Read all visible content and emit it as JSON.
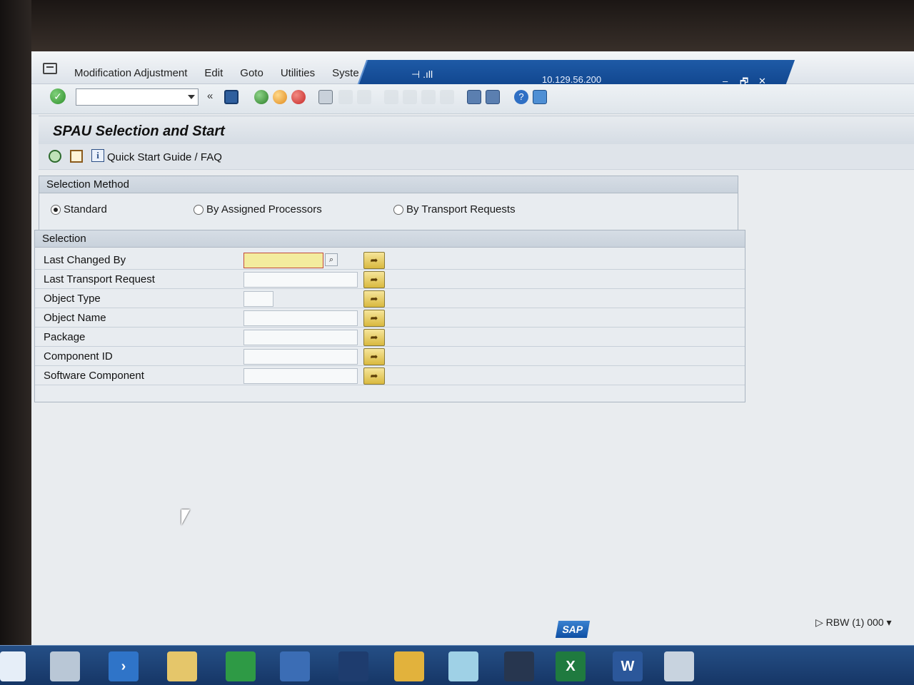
{
  "menubar": {
    "items": [
      "Modification Adjustment",
      "Edit",
      "Goto",
      "Utilities",
      "Syste"
    ],
    "server_ip": "10.129.56.200",
    "window_controls": [
      "–",
      "🗗",
      "✕"
    ]
  },
  "toolbar": {
    "back_label": "«"
  },
  "page": {
    "title": "SPAU Selection and Start",
    "quick_start_label": "Quick Start Guide / FAQ",
    "info_icon_text": "i"
  },
  "selection_method": {
    "title": "Selection Method",
    "options": [
      {
        "label": "Standard",
        "selected": true
      },
      {
        "label": "By Assigned Processors",
        "selected": false
      },
      {
        "label": "By Transport Requests",
        "selected": false
      }
    ]
  },
  "selection": {
    "title": "Selection",
    "fields": [
      {
        "label": "Last Changed By",
        "value": ""
      },
      {
        "label": "Last Transport Request",
        "value": ""
      },
      {
        "label": "Object Type",
        "value": ""
      },
      {
        "label": "Object Name",
        "value": ""
      },
      {
        "label": "Package",
        "value": ""
      },
      {
        "label": "Component ID",
        "value": ""
      },
      {
        "label": "Software Component",
        "value": ""
      }
    ]
  },
  "status": {
    "sap_logo": "SAP",
    "system": "RBW (1) 000"
  },
  "colors": {
    "title_band": "#0c3f86",
    "required_field": "#f3ec9e",
    "multi_button": "#d9b93f"
  }
}
